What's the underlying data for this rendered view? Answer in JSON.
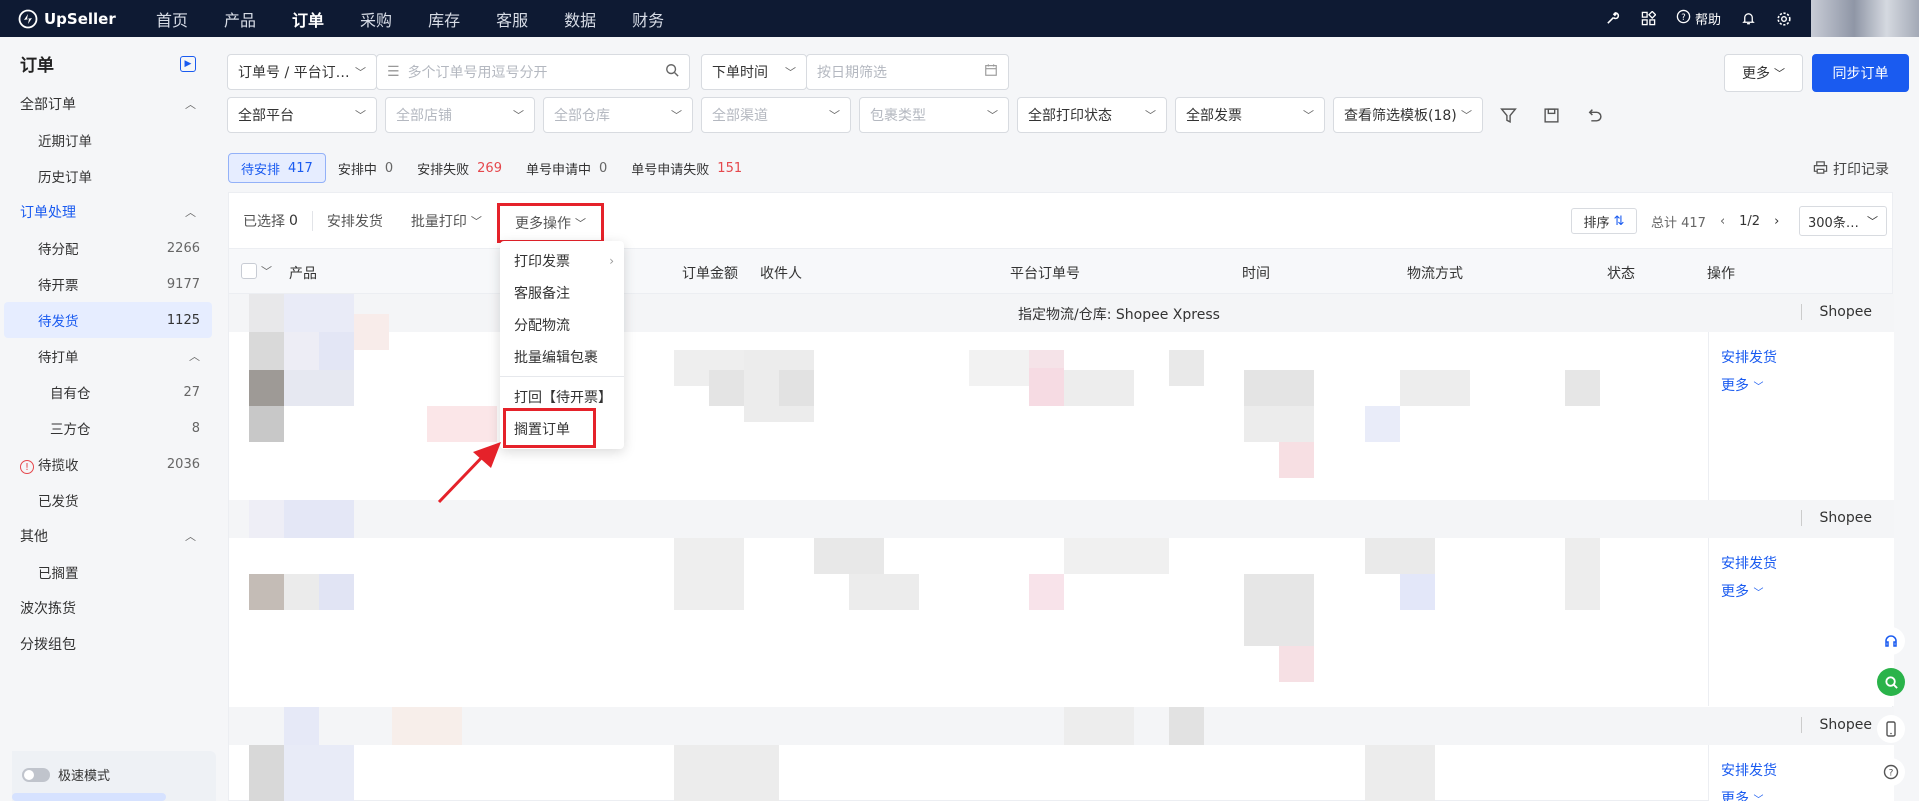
{
  "topbar": {
    "brand": "UpSeller",
    "nav": [
      "首页",
      "产品",
      "订单",
      "采购",
      "库存",
      "客服",
      "数据",
      "财务"
    ],
    "active_nav": "订单",
    "help": "帮助"
  },
  "sidebar": {
    "title": "订单",
    "all_orders": "全部订单",
    "recent": "近期订单",
    "history": "历史订单",
    "processing": "订单处理",
    "to_assign": {
      "label": "待分配",
      "count": "2266"
    },
    "to_invoice": {
      "label": "待开票",
      "count": "9177"
    },
    "to_ship": {
      "label": "待发货",
      "count": "1125"
    },
    "to_print": "待打单",
    "own_wh": {
      "label": "自有仓",
      "count": "27"
    },
    "third_wh": {
      "label": "三方仓",
      "count": "8"
    },
    "to_pickup": {
      "label": "待揽收",
      "count": "2036"
    },
    "shipped": "已发货",
    "other": "其他",
    "on_hold": "已搁置",
    "wave_pick": "波次拣货",
    "sort_pack": "分拨组包",
    "fast_mode": "极速模式"
  },
  "filters": {
    "order_no": "订单号 / 平台订…",
    "order_no_placeholder": "多个订单号用逗号分开",
    "time_type": "下单时间",
    "date_placeholder": "按日期筛选",
    "platform": "全部平台",
    "shop": "全部店铺",
    "warehouse": "全部仓库",
    "channel": "全部渠道",
    "package_type": "包裹类型",
    "print_status": "全部打印状态",
    "invoice": "全部发票",
    "template": "查看筛选模板(18)",
    "more": "更多",
    "sync": "同步订单"
  },
  "tabs": [
    {
      "label": "待安排",
      "count": "417",
      "red": false
    },
    {
      "label": "安排中",
      "count": "0",
      "red": false
    },
    {
      "label": "安排失败",
      "count": "269",
      "red": true
    },
    {
      "label": "单号申请中",
      "count": "0",
      "red": false
    },
    {
      "label": "单号申请失败",
      "count": "151",
      "red": true
    }
  ],
  "print_log": "打印记录",
  "toolbar": {
    "selected_label": "已选择",
    "selected_count": "0",
    "arrange": "安排发货",
    "batch_print": "批量打印",
    "more_ops": "更多操作",
    "sort": "排序",
    "total": "总计 417",
    "page": "1/2",
    "page_size": "300条…"
  },
  "columns": [
    "产品",
    "订单金额",
    "收件人",
    "平台订单号",
    "时间",
    "物流方式",
    "状态",
    "操作"
  ],
  "groups": [
    {
      "label_prefix": "指定物流/仓库:",
      "label_value": "Shopee Xpress",
      "shop": "Shopee"
    },
    {
      "shop": "Shopee"
    },
    {
      "shop": "Shopee"
    }
  ],
  "row_ops": {
    "arrange": "安排发货",
    "more": "更多"
  },
  "dropdown": [
    "打印发票",
    "客服备注",
    "分配物流",
    "批量编辑包裹",
    "打回【待开票】",
    "搁置订单"
  ],
  "colors": {
    "primary": "#1a5bf0",
    "topbar": "#0e1a33",
    "highlight": "#e5222a",
    "danger": "#e5484d"
  }
}
